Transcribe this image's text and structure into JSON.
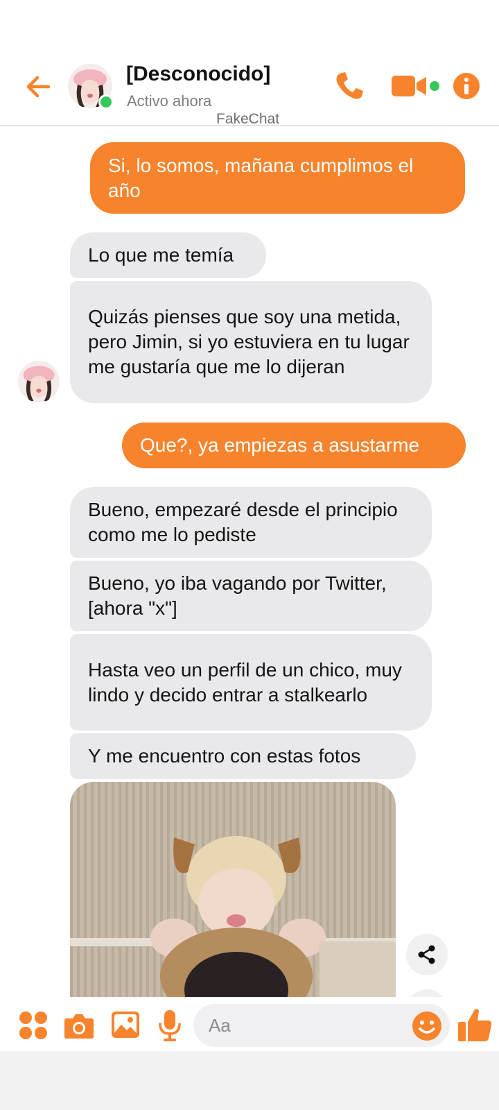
{
  "header": {
    "contact_name": "[Desconocido]",
    "status": "Activo ahora",
    "watermark": "FakeChat"
  },
  "colors": {
    "accent": "#f7832c",
    "incoming_bubble": "#e9e9eb",
    "online": "#34c759"
  },
  "icons": {
    "header": [
      "back-arrow-icon",
      "phone-icon",
      "video-camera-icon",
      "info-icon"
    ],
    "composer": [
      "apps-icon",
      "camera-icon",
      "gallery-icon",
      "microphone-icon",
      "emoji-icon",
      "thumbs-up-icon"
    ],
    "message_action": "share-icon"
  },
  "messages": [
    {
      "direction": "outgoing",
      "text": "Si, lo somos, mañana cumplimos el año"
    },
    {
      "direction": "incoming",
      "text": "Lo que me temía"
    },
    {
      "direction": "incoming",
      "text": "Quizás pienses que soy una metida, pero Jimin, si yo estuviera en tu lugar me gustaría que me lo dijeran"
    },
    {
      "direction": "outgoing",
      "text": "Que?, ya empiezas a asustarme"
    },
    {
      "direction": "incoming",
      "text": "Bueno, empezaré desde el principio como me lo pediste"
    },
    {
      "direction": "incoming",
      "text": "Bueno, yo iba vagando por Twitter, [ahora \"x\"]"
    },
    {
      "direction": "incoming",
      "text": "Hasta veo un perfil de un chico, muy lindo y decido entrar a stalkearlo"
    },
    {
      "direction": "incoming",
      "text": "Y me encuentro con estas fotos"
    }
  ],
  "composer": {
    "placeholder": "Aa"
  }
}
